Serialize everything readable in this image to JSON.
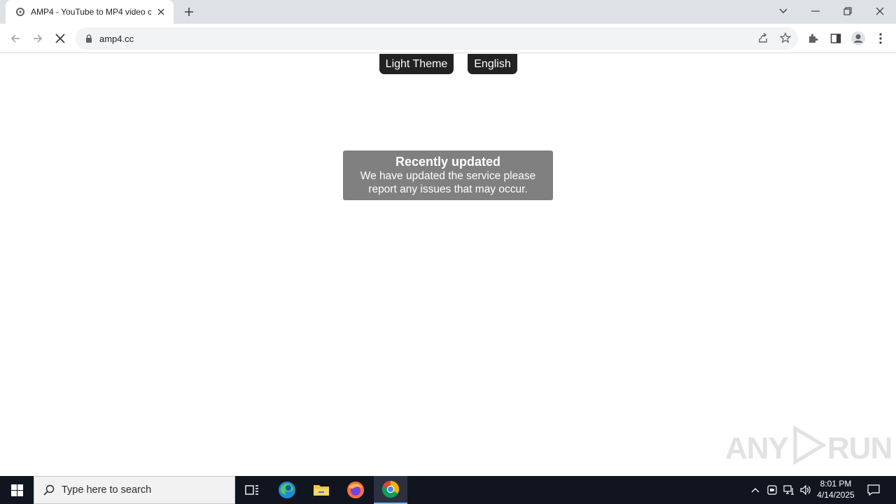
{
  "browser": {
    "tab_title": "AMP4 - YouTube to MP4 video c",
    "url": "amp4.cc"
  },
  "page": {
    "theme_button": "Light Theme",
    "language_button": "English",
    "notice_title": "Recently updated",
    "notice_body_line1": "We have updated the service please",
    "notice_body_line2": "report any issues that may occur."
  },
  "watermark": {
    "left": "ANY",
    "right": "RUN"
  },
  "taskbar": {
    "search_placeholder": "Type here to search",
    "time": "8:01 PM",
    "date": "4/14/2025"
  },
  "colors": {
    "pill_bg": "#222222",
    "notice_bg": "#808080",
    "taskbar_bg": "#101520",
    "chrome_frame": "#dee1e6"
  }
}
